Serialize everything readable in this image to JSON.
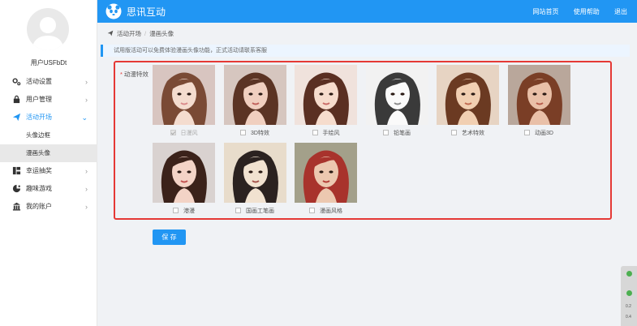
{
  "sidebar": {
    "username": "用户USFbDt",
    "menu": [
      {
        "label": "活动设置",
        "icon": "gears-icon"
      },
      {
        "label": "用户管理",
        "icon": "lock-icon"
      },
      {
        "label": "活动开场",
        "icon": "paper-plane-icon"
      },
      {
        "label": "幸运抽奖",
        "icon": "gift-icon"
      },
      {
        "label": "趣味游戏",
        "icon": "gamepad-icon"
      },
      {
        "label": "我的账户",
        "icon": "bank-icon"
      }
    ],
    "submenu": [
      {
        "label": "头像边框"
      },
      {
        "label": "漫画头像"
      }
    ]
  },
  "header": {
    "title": "思讯互动",
    "links": [
      "网站首页",
      "使用帮助",
      "退出"
    ]
  },
  "breadcrumb": [
    "活动开场",
    "漫画头像"
  ],
  "notice": "试用版活动可以免费体验漫画头像功能，正式活动请联系客服",
  "form": {
    "field_label": "动漫特效",
    "required_mark": "*",
    "options": [
      {
        "label": "日漫风",
        "checked": true,
        "style": "anime"
      },
      {
        "label": "3D特效",
        "checked": false,
        "style": "3d"
      },
      {
        "label": "手绘风",
        "checked": false,
        "style": "handdrawn"
      },
      {
        "label": "铅笔画",
        "checked": false,
        "style": "pencil"
      },
      {
        "label": "艺术特效",
        "checked": false,
        "style": "art"
      },
      {
        "label": "动画3D",
        "checked": false,
        "style": "anim3d"
      },
      {
        "label": "港漫",
        "checked": false,
        "style": "hk"
      },
      {
        "label": "国画工笔画",
        "checked": false,
        "style": "ink"
      },
      {
        "label": "漫画风格",
        "checked": false,
        "style": "comic"
      }
    ],
    "save_label": "保 存"
  },
  "float_panel": {
    "line1": "0.2",
    "line2": "0.4"
  },
  "colors": {
    "primary": "#2196f3",
    "highlight": "#e53935"
  }
}
